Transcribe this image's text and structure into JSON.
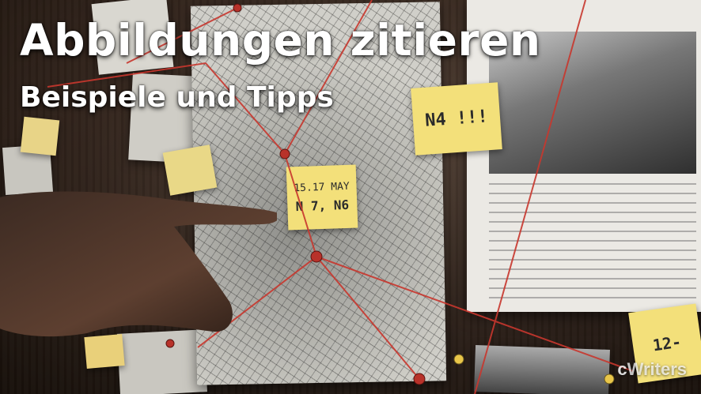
{
  "title": "Abbildungen zitieren",
  "subtitle": "Beispiele und Tipps",
  "logo_text": "Writers",
  "notes": {
    "sticky_a": "N4 !!!",
    "sticky_b_line1": "15.17 MAY",
    "sticky_b_line2": "N 7, N6",
    "sticky_c": "12-"
  },
  "colors": {
    "string": "#c8372e",
    "sticky": "#f3e07a",
    "title_text": "#ffffff"
  }
}
